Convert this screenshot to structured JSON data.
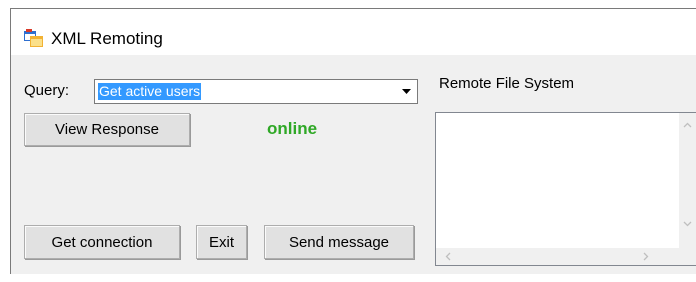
{
  "window": {
    "title": "XML Remoting"
  },
  "query": {
    "label": "Query:",
    "selected": "Get active users"
  },
  "buttons": {
    "view_response": "View Response",
    "get_connection": "Get connection",
    "exit": "Exit",
    "send_message": "Send message"
  },
  "status": {
    "text": "online",
    "color": "#2fa826"
  },
  "remote_fs": {
    "label": "Remote File System"
  },
  "icons": {
    "app": "app-window-icon",
    "dropdown": "chevron-down-icon",
    "scroll_up": "scroll-up-icon",
    "scroll_down": "scroll-down-icon",
    "scroll_left": "scroll-left-icon",
    "scroll_right": "scroll-right-icon"
  }
}
